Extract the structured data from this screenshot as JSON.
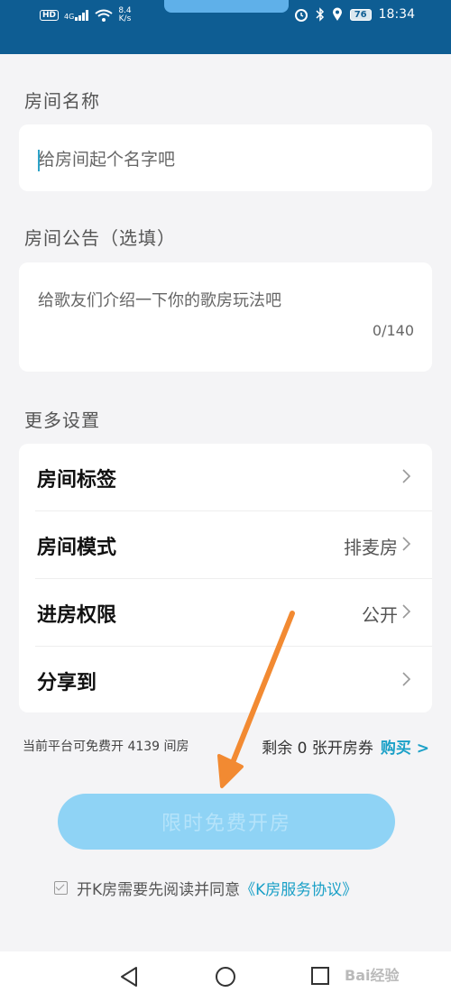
{
  "status_bar": {
    "hd": "HD",
    "network": "4G",
    "speed_value": "8.4",
    "speed_unit": "K/s",
    "battery": "76",
    "time": "18:34"
  },
  "form": {
    "room_name": {
      "label": "房间名称",
      "placeholder": "给房间起个名字吧"
    },
    "announcement": {
      "label": "房间公告（选填）",
      "placeholder": "给歌友们介绍一下你的歌房玩法吧",
      "counter": "0/140"
    },
    "more_settings": {
      "label": "更多设置",
      "rows": [
        {
          "label": "房间标签",
          "value": ""
        },
        {
          "label": "房间模式",
          "value": "排麦房"
        },
        {
          "label": "进房权限",
          "value": "公开"
        },
        {
          "label": "分享到",
          "value": ""
        }
      ]
    }
  },
  "info": {
    "free_quota": "当前平台可免费开 4139 间房",
    "remaining": "剩余 0 张开房券",
    "buy": "购买 >"
  },
  "open_button": "限时免费开房",
  "agreement": {
    "text": "开K房需要先阅读并同意",
    "link": "《K房服务协议》"
  },
  "watermark": "Bai经验"
}
